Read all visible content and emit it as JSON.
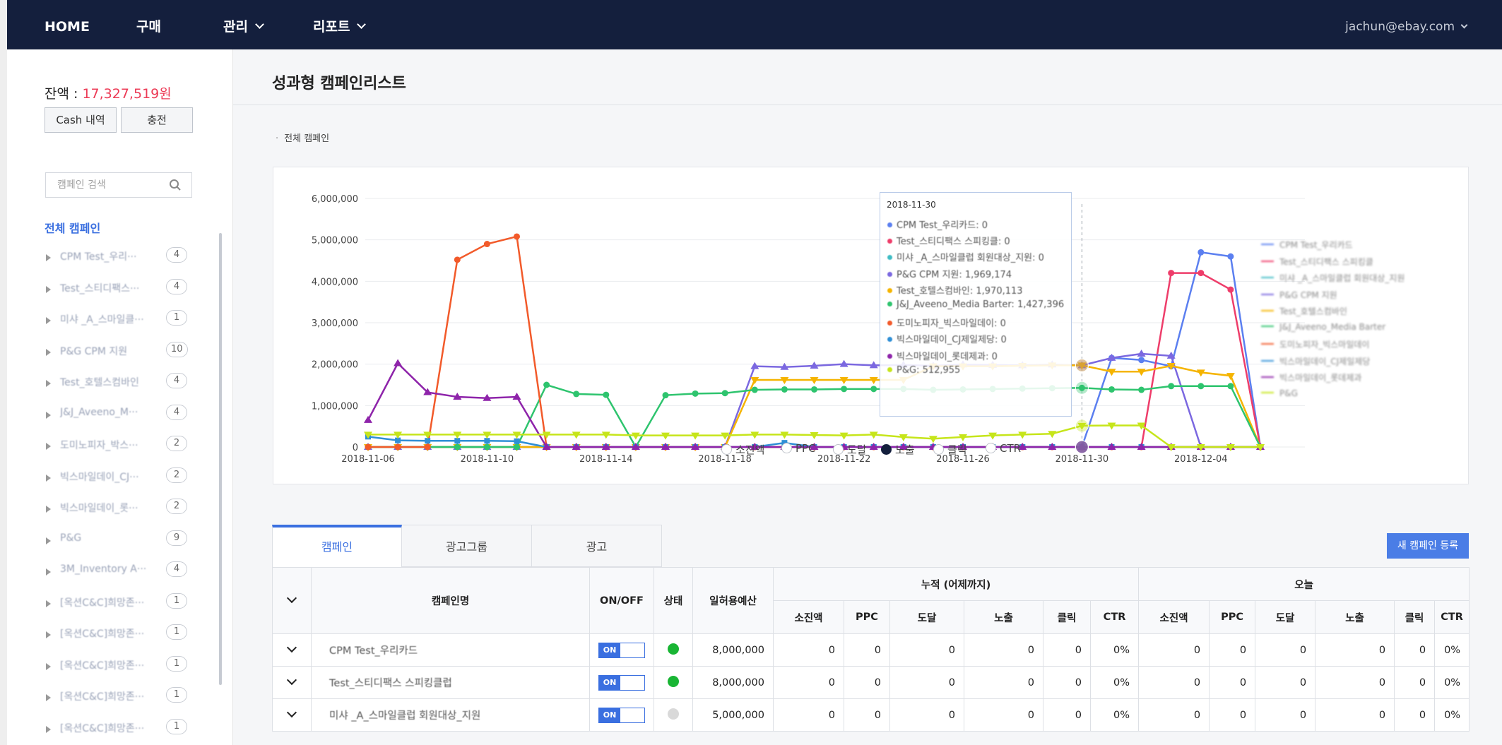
{
  "nav": {
    "items": [
      "HOME",
      "구매",
      "관리",
      "리포트"
    ],
    "user": "jachun@ebay.com"
  },
  "sidebar": {
    "balance_label": "잔액 : ",
    "balance_amount": "17,327,519원",
    "cash_button": "Cash 내역",
    "charge_button": "충전",
    "search_placeholder": "캠페인 검색",
    "all_campaigns": "전체 캠페인",
    "items": [
      {
        "label": "CPM Test_우리···",
        "count": "4"
      },
      {
        "label": "Test_스티디팩스···",
        "count": "4"
      },
      {
        "label": "미샤 _A_스마일클···",
        "count": "1"
      },
      {
        "label": "P&G CPM 지원",
        "count": "10"
      },
      {
        "label": "Test_호텔스컴바인",
        "count": "4"
      },
      {
        "label": "J&J_Aveeno_M···",
        "count": "4"
      },
      {
        "label": "도미노피자_박스···",
        "count": "2"
      },
      {
        "label": "빅스마일데이_CJ···",
        "count": "2"
      },
      {
        "label": "빅스마일데이_롯···",
        "count": "2"
      },
      {
        "label": "P&G",
        "count": "9"
      },
      {
        "label": "3M_Inventory A···",
        "count": "4"
      },
      {
        "label": "[옥션C&C]희망존···",
        "count": "1"
      },
      {
        "label": "[옥션C&C]희망존···",
        "count": "1"
      },
      {
        "label": "[옥션C&C]희망존···",
        "count": "1"
      },
      {
        "label": "[옥션C&C]희망존···",
        "count": "1"
      },
      {
        "label": "[옥션C&C]희망존···",
        "count": "1"
      }
    ]
  },
  "page": {
    "title": "성과형 캠페인리스트",
    "crumb": "전체 캠페인"
  },
  "metrics": [
    {
      "label": "소진액",
      "selected": false
    },
    {
      "label": "PPC",
      "selected": false
    },
    {
      "label": "도달",
      "selected": false
    },
    {
      "label": "노출",
      "selected": true
    },
    {
      "label": "클릭",
      "selected": false
    },
    {
      "label": "CTR",
      "selected": false
    }
  ],
  "tooltip": {
    "date": "2018-11-30",
    "rows": [
      {
        "text": "CPM Test_우리카드: 0",
        "color": "#5b7ff0"
      },
      {
        "text": "Test_스티디팩스 스피킹클: 0",
        "color": "#ee3d6a"
      },
      {
        "text": "미샤 _A_스마일클럽 회원대상_지원: 0",
        "color": "#3fbcc4"
      },
      {
        "text": "P&G CPM 지원: 1,969,174",
        "color": "#7b68e0"
      },
      {
        "text": "Test_호텔스컴바인: 1,970,113",
        "color": "#f5b400"
      },
      {
        "text": "J&J_Aveeno_Media Barter: 1,427,396",
        "color": "#2ec46e"
      },
      {
        "text": "도미노피자_빅스마일데이: 0",
        "color": "#f25a2a"
      },
      {
        "text": "빅스마일데이_CJ제일제당: 0",
        "color": "#2f8fd6"
      },
      {
        "text": "빅스마일데이_롯데제과: 0",
        "color": "#8e24aa"
      },
      {
        "text": "P&G: 512,955",
        "color": "#c6e51a"
      }
    ]
  },
  "chart_data": {
    "type": "line",
    "metric": "노출",
    "x": [
      "2018-11-06",
      "2018-11-07",
      "2018-11-08",
      "2018-11-09",
      "2018-11-10",
      "2018-11-11",
      "2018-11-12",
      "2018-11-13",
      "2018-11-14",
      "2018-11-15",
      "2018-11-16",
      "2018-11-17",
      "2018-11-18",
      "2018-11-19",
      "2018-11-20",
      "2018-11-21",
      "2018-11-22",
      "2018-11-23",
      "2018-11-24",
      "2018-11-25",
      "2018-11-26",
      "2018-11-27",
      "2018-11-28",
      "2018-11-29",
      "2018-11-30",
      "2018-12-01",
      "2018-12-02",
      "2018-12-03",
      "2018-12-04",
      "2018-12-05",
      "2018-12-06"
    ],
    "x_ticks": [
      "2018-11-06",
      "2018-11-10",
      "2018-11-14",
      "2018-11-18",
      "2018-11-22",
      "2018-11-26",
      "2018-11-30",
      "2018-12-04"
    ],
    "y_ticks": [
      "0",
      "1,000,000",
      "2,000,000",
      "3,000,000",
      "4,000,000",
      "5,000,000",
      "6,000,000"
    ],
    "ylim": [
      0,
      6000000
    ],
    "grid": true,
    "legend": "right",
    "series": [
      {
        "name": "CPM Test_우리카드",
        "color": "#5b7ff0",
        "marker": "circle",
        "values": [
          0,
          0,
          0,
          0,
          0,
          0,
          0,
          0,
          0,
          0,
          0,
          0,
          0,
          0,
          0,
          0,
          0,
          0,
          0,
          0,
          0,
          0,
          0,
          0,
          0,
          2150000,
          2100000,
          1950000,
          4700000,
          4600000,
          0
        ]
      },
      {
        "name": "Test_스티디팩스 스피킹클",
        "color": "#ee3d6a",
        "marker": "circle",
        "values": [
          0,
          0,
          0,
          0,
          0,
          0,
          0,
          0,
          0,
          0,
          0,
          0,
          0,
          0,
          0,
          0,
          0,
          0,
          0,
          0,
          0,
          0,
          0,
          0,
          0,
          0,
          0,
          4200000,
          4200000,
          3800000,
          0
        ]
      },
      {
        "name": "미샤 _A_스마일클럽 회원대상_지원",
        "color": "#3fbcc4",
        "marker": "square",
        "values": [
          0,
          0,
          0,
          0,
          0,
          0,
          0,
          0,
          0,
          0,
          0,
          0,
          0,
          0,
          0,
          0,
          0,
          0,
          0,
          0,
          0,
          0,
          0,
          0,
          0,
          0,
          0,
          0,
          0,
          0,
          0
        ]
      },
      {
        "name": "P&G CPM 지원",
        "color": "#7b68e0",
        "marker": "triangle",
        "values": [
          0,
          0,
          0,
          0,
          0,
          0,
          0,
          0,
          0,
          0,
          0,
          0,
          0,
          1950000,
          1930000,
          1960000,
          2000000,
          1970000,
          1980000,
          1960000,
          1990000,
          1980000,
          1970000,
          1990000,
          1969174,
          2150000,
          2250000,
          2200000,
          0,
          0,
          0
        ]
      },
      {
        "name": "Test_호텔스컴바인",
        "color": "#f5b400",
        "marker": "triangle-down",
        "values": [
          0,
          0,
          0,
          0,
          0,
          0,
          0,
          0,
          0,
          0,
          0,
          0,
          0,
          1620000,
          1620000,
          1620000,
          1620000,
          1620000,
          1620000,
          1950000,
          1950000,
          1950000,
          1960000,
          1970000,
          1970113,
          1820000,
          1820000,
          1960000,
          1800000,
          1720000,
          0
        ]
      },
      {
        "name": "J&J_Aveeno_Media Barter",
        "color": "#2ec46e",
        "marker": "circle",
        "values": [
          0,
          0,
          0,
          0,
          0,
          0,
          1500000,
          1280000,
          1260000,
          0,
          1250000,
          1290000,
          1300000,
          1380000,
          1390000,
          1390000,
          1400000,
          1400000,
          1400000,
          1380000,
          1390000,
          1400000,
          1410000,
          1420000,
          1427396,
          1390000,
          1380000,
          1470000,
          1470000,
          1470000,
          0
        ]
      },
      {
        "name": "도미노피자_빅스마일데이",
        "color": "#f25a2a",
        "marker": "circle",
        "values": [
          0,
          0,
          0,
          4520000,
          4900000,
          5080000,
          0,
          0,
          0,
          0,
          0,
          0,
          0,
          0,
          0,
          0,
          0,
          0,
          0,
          0,
          0,
          0,
          0,
          0,
          0,
          0,
          0,
          0,
          0,
          0,
          0
        ]
      },
      {
        "name": "빅스마일데이_CJ제일제당",
        "color": "#2f8fd6",
        "marker": "square",
        "values": [
          250000,
          160000,
          150000,
          150000,
          150000,
          140000,
          0,
          0,
          0,
          0,
          0,
          0,
          0,
          0,
          100000,
          0,
          0,
          0,
          0,
          0,
          0,
          0,
          0,
          0,
          0,
          0,
          0,
          0,
          0,
          0,
          0
        ]
      },
      {
        "name": "빅스마일데이_롯데제과",
        "color": "#8e24aa",
        "marker": "triangle",
        "values": [
          650000,
          2020000,
          1320000,
          1210000,
          1180000,
          1210000,
          0,
          0,
          0,
          0,
          0,
          0,
          0,
          0,
          0,
          0,
          0,
          0,
          0,
          0,
          0,
          0,
          0,
          0,
          0,
          0,
          0,
          0,
          0,
          0,
          0
        ]
      },
      {
        "name": "P&G",
        "color": "#c6e51a",
        "marker": "triangle-down",
        "values": [
          300000,
          300000,
          300000,
          300000,
          300000,
          300000,
          300000,
          300000,
          300000,
          280000,
          280000,
          280000,
          280000,
          300000,
          300000,
          290000,
          280000,
          300000,
          240000,
          200000,
          240000,
          280000,
          300000,
          320000,
          512955,
          520000,
          520000,
          0,
          0,
          0,
          0
        ]
      }
    ]
  },
  "tabs": [
    "캠페인",
    "광고그룹",
    "광고"
  ],
  "new_campaign_button": "새 캠페인 등록",
  "table": {
    "headers": {
      "campaign_name": "캠페인명",
      "onoff": "ON/OFF",
      "status": "상태",
      "daily_budget": "일허용예산",
      "cumulative": "누적 (어제까지)",
      "today": "오늘",
      "metrics": [
        "소진액",
        "PPC",
        "도달",
        "노출",
        "클릭",
        "CTR"
      ]
    },
    "rows": [
      {
        "name": "CPM Test_우리카드",
        "toggle": "ON",
        "status_color": "#19b534",
        "budget": "8,000,000",
        "cum": [
          "0",
          "0",
          "0",
          "0",
          "0",
          "0%"
        ],
        "today": [
          "0",
          "0",
          "0",
          "0",
          "0",
          "0%"
        ]
      },
      {
        "name": "Test_스티디팩스 스피킹클럽",
        "toggle": "ON",
        "status_color": "#19b534",
        "budget": "8,000,000",
        "cum": [
          "0",
          "0",
          "0",
          "0",
          "0",
          "0%"
        ],
        "today": [
          "0",
          "0",
          "0",
          "0",
          "0",
          "0%"
        ]
      },
      {
        "name": "미샤 _A_스마일클럽 회원대상_지원",
        "toggle": "ON",
        "status_color": "#d9d9d9",
        "budget": "5,000,000",
        "cum": [
          "0",
          "0",
          "0",
          "0",
          "0",
          "0%"
        ],
        "today": [
          "0",
          "0",
          "0",
          "0",
          "0",
          "0%"
        ]
      }
    ]
  }
}
